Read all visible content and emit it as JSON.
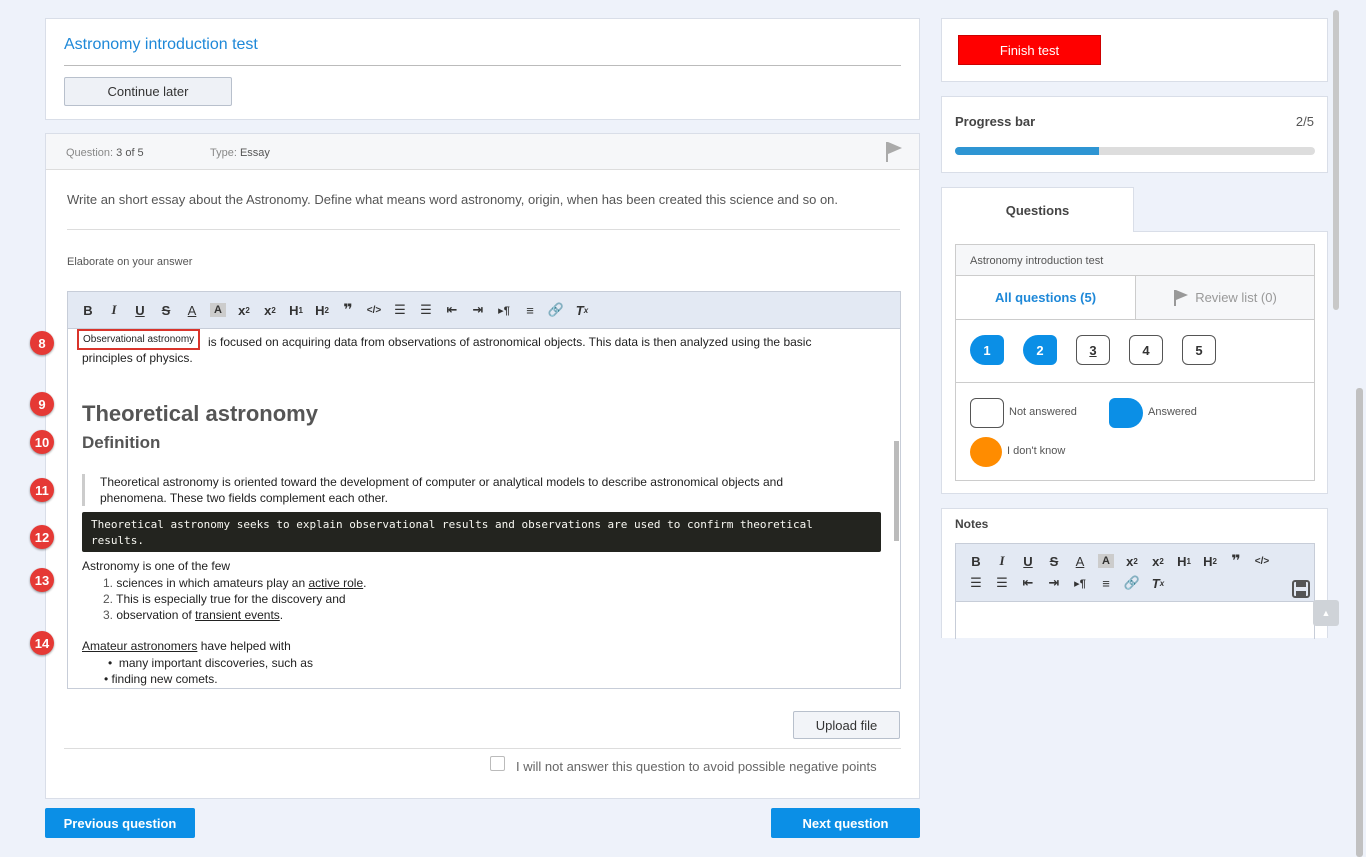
{
  "header": {
    "title": "Astronomy introduction test",
    "continue_label": "Continue later"
  },
  "question": {
    "meta_label": "Question:",
    "meta_value": "3 of 5",
    "type_label": "Type:",
    "type_value": "Essay",
    "text": "Write an short essay about the Astronomy. Define what means word astronomy, origin, when has been created this science and so on.",
    "elaborate_label": "Elaborate on your answer"
  },
  "editor": {
    "toolbar": [
      "B",
      "I",
      "U",
      "S",
      "A",
      "A",
      "x₂",
      "x²",
      "H₁",
      "H₂",
      "❞",
      "</>",
      "ol",
      "ul",
      "out",
      "in",
      "¶",
      "≡",
      "link",
      "Tx"
    ],
    "tooltip": "Observational astronomy",
    "para1": "is focused on acquiring data from observations of astronomical objects. This data is then analyzed using the basic",
    "para1b": "principles of physics.",
    "h1": "Theoretical astronomy",
    "h2": "Definition",
    "quote": "Theoretical astronomy is oriented toward the development of computer or analytical models to describe astronomical objects and phenomena. These two fields complement each other.",
    "code": "Theoretical astronomy seeks to explain observational results and observations are used to confirm theoretical results.",
    "list_intro": "Astronomy is one of the few",
    "ol": [
      {
        "num": "1.",
        "pre": "sciences in which amateurs play an ",
        "link": "active role",
        "post": "."
      },
      {
        "num": "2.",
        "pre": "This is especially true for the discovery and",
        "link": "",
        "post": ""
      },
      {
        "num": "3.",
        "pre": " observation of ",
        "link": "transient events",
        "post": "."
      }
    ],
    "ul_intro_link": "Amateur astronomers",
    "ul_intro_rest": " have helped with",
    "ul": [
      "many important discoveries, such as",
      "finding new comets."
    ],
    "markers": [
      "8",
      "9",
      "10",
      "11",
      "12",
      "13",
      "14"
    ]
  },
  "footer": {
    "upload_label": "Upload file",
    "skip_label": "I will not answer this question to avoid possible negative points",
    "prev_label": "Previous question",
    "next_label": "Next question"
  },
  "side": {
    "finish_label": "Finish test",
    "progress_label": "Progress bar",
    "progress_value": "2/5",
    "progress_fraction": 0.4,
    "questions_tab": "Questions",
    "test_name": "Astronomy introduction test",
    "all_questions": "All questions (5)",
    "review_list": "Review list (0)",
    "numbers": [
      "1",
      "2",
      "3",
      "4",
      "5"
    ],
    "legend_not_answered": "Not answered",
    "legend_answered": "Answered",
    "legend_dont_know": "I don't know",
    "notes_label": "Notes"
  },
  "colors": {
    "accent": "#0b8fe6",
    "finish": "#ff0000",
    "dontknow": "#ff8c00",
    "progress": "#2e95d3"
  }
}
